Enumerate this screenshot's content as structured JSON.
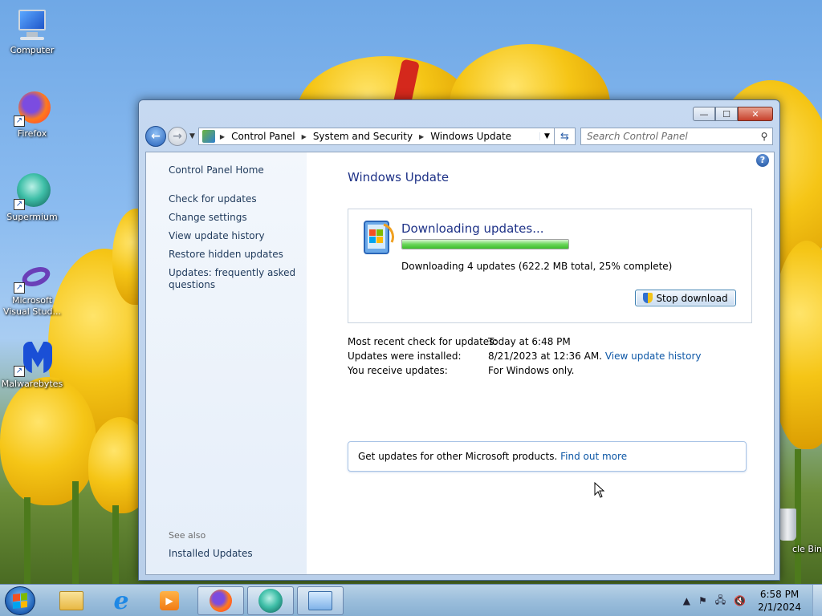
{
  "desktop": {
    "icons": [
      {
        "label": "Computer"
      },
      {
        "label": "Firefox"
      },
      {
        "label": "Supermium"
      },
      {
        "label": "Microsoft Visual Stud..."
      },
      {
        "label": "Malwarebytes"
      },
      {
        "label": "cle Bin"
      }
    ]
  },
  "window": {
    "caption_buttons": {
      "minimize": "—",
      "maximize": "☐",
      "close": "✕"
    },
    "nav": {
      "breadcrumb": [
        "Control Panel",
        "System and Security",
        "Windows Update"
      ],
      "search_placeholder": "Search Control Panel"
    },
    "left_pane": {
      "home": "Control Panel Home",
      "links": [
        "Check for updates",
        "Change settings",
        "View update history",
        "Restore hidden updates",
        "Updates: frequently asked questions"
      ],
      "see_also_title": "See also",
      "see_also_links": [
        "Installed Updates"
      ]
    },
    "main": {
      "title": "Windows Update",
      "download": {
        "heading": "Downloading updates...",
        "progress_fraction": 1.0,
        "status": "Downloading 4 updates (622.2 MB total, 25% complete)",
        "stop_button": "Stop download"
      },
      "info": [
        {
          "label": "Most recent check for updates:",
          "value": "Today at 6:48 PM",
          "link": ""
        },
        {
          "label": "Updates were installed:",
          "value": "8/21/2023 at 12:36 AM.",
          "link": "View update history"
        },
        {
          "label": "You receive updates:",
          "value": "For Windows only.",
          "link": ""
        }
      ],
      "other_products": {
        "text": "Get updates for other Microsoft products.",
        "link": "Find out more"
      }
    }
  },
  "taskbar": {
    "clock_time": "6:58 PM",
    "clock_date": "2/1/2024",
    "tray_icons": [
      "show-hidden-icons",
      "action-center-flag-icon",
      "network-icon",
      "volume-muted-icon"
    ]
  },
  "colors": {
    "title_blue": "#1e3287",
    "link_blue": "#0d57a6",
    "progress_green": "#3cbd2c"
  }
}
